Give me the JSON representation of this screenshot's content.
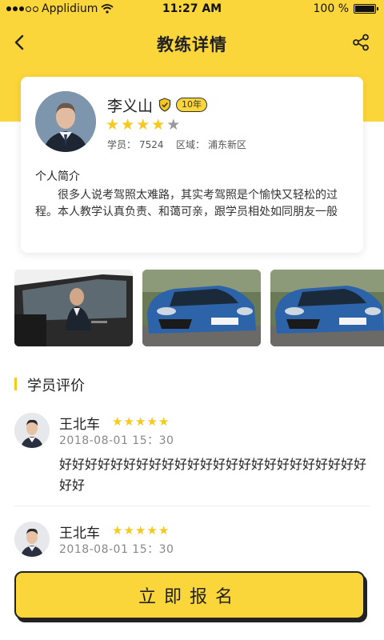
{
  "status_bar": {
    "carrier": "Applidium",
    "time": "11:27 AM",
    "battery_text": "100 %",
    "battery_level": 1.0
  },
  "nav": {
    "title": "教练详情",
    "back_icon": "chevron-left-icon",
    "share_icon": "share-icon"
  },
  "coach": {
    "name": "李义山",
    "years_badge": "10年",
    "rating": 4,
    "rating_max": 5,
    "students_label": "学员：",
    "students_count": "7524",
    "area_label": "区域：",
    "area_value": "浦东新区",
    "intro_title": "个人简介",
    "intro_text": "很多人说考驾照太难路，其实考驾照是个愉快又轻松的过程。本人教学认真负责、和蔼可亲，跟学员相处如同朋友一般"
  },
  "photos": [
    {
      "subject": "coach-in-car"
    },
    {
      "subject": "blue-car"
    },
    {
      "subject": "blue-car"
    }
  ],
  "reviews_section": {
    "title": "学员评价"
  },
  "reviews": [
    {
      "name": "王北车",
      "rating": 5,
      "time": "2018-08-01 15：30",
      "text": "好好好好好好好好好好好好好好好好好好好好好好好好好好"
    },
    {
      "name": "王北车",
      "rating": 5,
      "time": "2018-08-01 15：30",
      "text": ""
    }
  ],
  "enroll_button": {
    "label": "立即报名"
  },
  "colors": {
    "accent": "#fbd63a",
    "star_on": "#f7c81e",
    "star_off": "#9a9a9a"
  }
}
